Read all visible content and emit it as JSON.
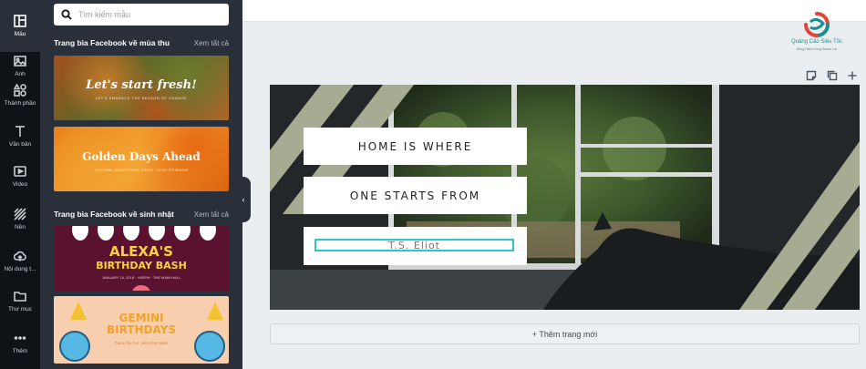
{
  "rail": [
    {
      "label": "Mẫu",
      "icon": "layout-icon",
      "active": true
    },
    {
      "label": "Ảnh",
      "icon": "image-icon"
    },
    {
      "label": "Thành phần",
      "icon": "shapes-icon"
    },
    {
      "label": "Văn bản",
      "icon": "text-icon"
    },
    {
      "label": "Video",
      "icon": "video-icon"
    },
    {
      "label": "Nền",
      "icon": "background-icon"
    },
    {
      "label": "Nội dung t...",
      "icon": "upload-icon"
    },
    {
      "label": "Thư mục",
      "icon": "folder-icon"
    },
    {
      "label": "Thêm",
      "icon": "more-icon"
    }
  ],
  "search": {
    "placeholder": "Tìm kiếm mẫu"
  },
  "sections": [
    {
      "title": "Trang bìa Facebook về mùa thu",
      "link": "Xem tất cả",
      "templates": [
        {
          "title": "Let's start fresh!",
          "subtitle": "LET'S EMBRACE THE SEASON OF CHANGE"
        },
        {
          "title": "Golden Days Ahead",
          "subtitle": "AUTUMN GREETINGS FROM YOUR FRIENDS"
        }
      ]
    },
    {
      "title": "Trang bìa Facebook về sinh nhật",
      "link": "Xem tất cả",
      "templates": [
        {
          "title_1": "ALEXA'S",
          "title_2": "BIRTHDAY BASH",
          "subtitle": "JANUARY 15, 2018 · 4:00PM · THE MAIN HALL"
        },
        {
          "title_1": "GEMINI",
          "title_2": "BIRTHDAYS",
          "subtitle": "Twice the fun, twice the cake!"
        }
      ]
    }
  ],
  "collapse_icon": "‹",
  "logo": {
    "name": "Quảng Cáo Siêu Tốc",
    "tagline": "Đồng Hành Cùng Doanh Lợi"
  },
  "toolbar": [
    {
      "icon": "note-icon"
    },
    {
      "icon": "duplicate-icon"
    },
    {
      "icon": "plus-icon"
    }
  ],
  "design": {
    "line_1": "HOME IS WHERE",
    "line_2": "ONE STARTS FROM",
    "author": "T.S. Eliot"
  },
  "add_page_label": "+ Thêm trang mới",
  "colors": {
    "rail": "#0e1318",
    "panel": "#293039",
    "selection": "#2cc6c8",
    "stripe": "#a7ab92"
  }
}
